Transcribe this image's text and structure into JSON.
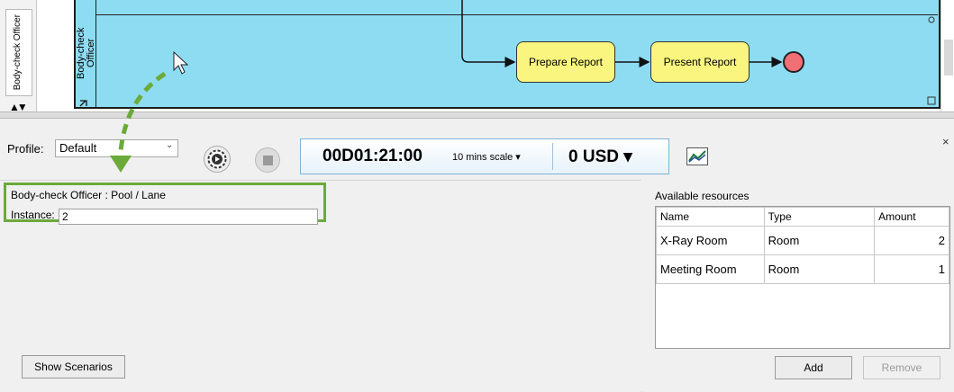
{
  "diagram": {
    "pool_label": "Body-check Officer",
    "lane_label": "Body-check Officer",
    "tasks": [
      "Prepare Report",
      "Present Report"
    ],
    "lane_color": "#8ddcf2",
    "task_color": "#f9f57e",
    "end_event_color": "#f26f76"
  },
  "toolbar": {
    "profile_label": "Profile:",
    "profile_value": "Default",
    "time": "00D01:21:00",
    "time_scale": "10 mins scale ▾",
    "cost": "0  USD ▾",
    "close": "×",
    "icons": [
      "play-icon",
      "stop-icon",
      "chart-icon",
      "close-icon"
    ]
  },
  "properties": {
    "title": "Body-check Officer : Pool / Lane",
    "instance_label": "Instance:",
    "instance_value": "2",
    "highlight_color": "#6caa3a"
  },
  "buttons": {
    "show_scenarios": "Show Scenarios",
    "add": "Add",
    "remove": "Remove"
  },
  "resources": {
    "title": "Available resources",
    "columns": [
      "Name",
      "Type",
      "Amount"
    ],
    "rows": [
      {
        "name": "X-Ray Room",
        "type": "Room",
        "amount": "2"
      },
      {
        "name": "Meeting Room",
        "type": "Room",
        "amount": "1"
      }
    ]
  }
}
